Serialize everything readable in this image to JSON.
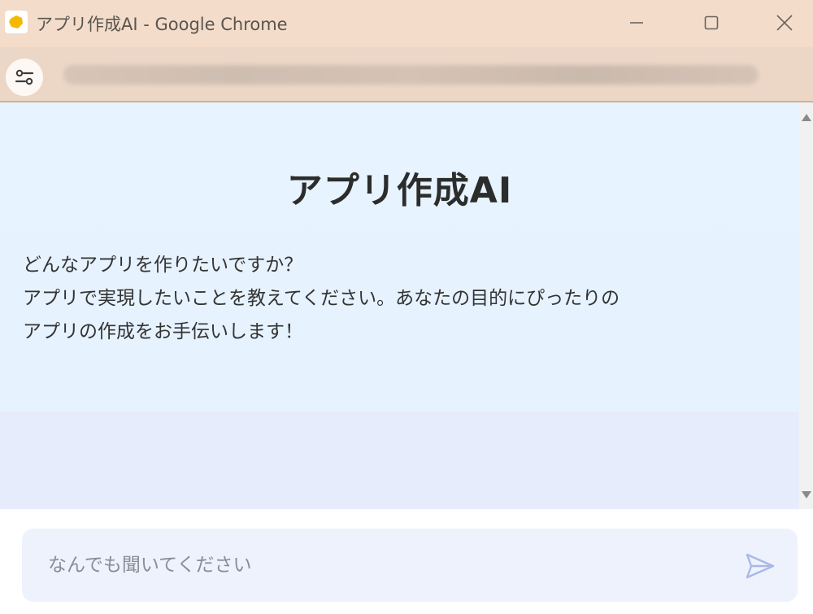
{
  "window": {
    "title": "アプリ作成AI - Google Chrome"
  },
  "icons": {
    "app": "app-logo-icon",
    "minimize": "minimize-icon",
    "maximize": "maximize-icon",
    "close": "close-icon",
    "site_info": "site-settings-icon",
    "send": "send-icon"
  },
  "page": {
    "title": "アプリ作成AI",
    "intro_lines": [
      "どんなアプリを作りたいですか？",
      "アプリで実現したいことを教えてください。あなたの目的にぴったりの",
      "アプリの作成をお手伝いします！"
    ]
  },
  "chat": {
    "placeholder": "なんでも聞いてください"
  },
  "colors": {
    "titlebar": "#f3dcc9",
    "addressbar": "#ecd7c7",
    "hero_bg": "#e7f3fe",
    "lower_bg": "#e7ecfd",
    "input_bg": "#eef2fd",
    "send_icon": "#a9b8e6",
    "app_icon": "#f5b800"
  }
}
